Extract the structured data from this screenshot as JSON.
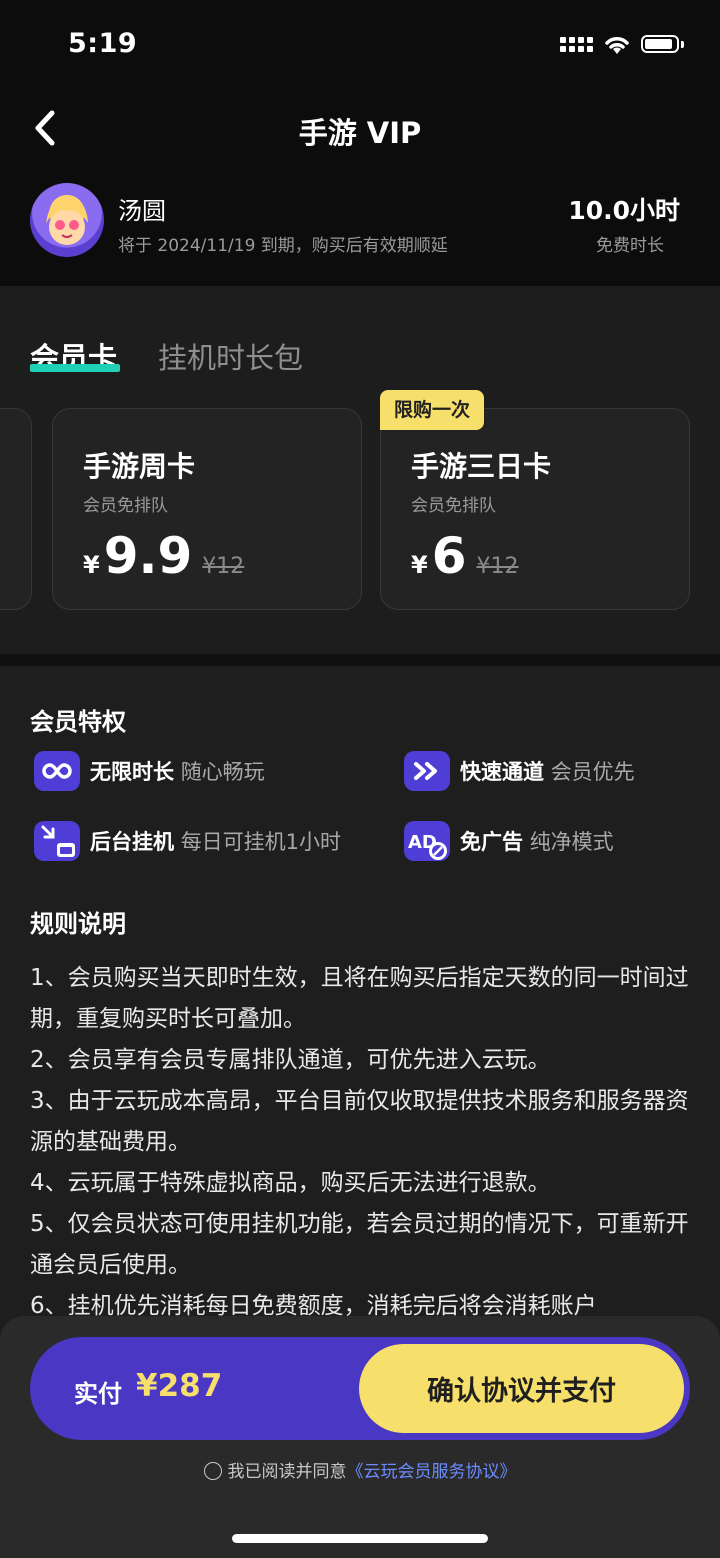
{
  "status": {
    "time": "5:19"
  },
  "header": {
    "title": "手游 VIP"
  },
  "user": {
    "name": "汤圆",
    "expire": "将于 2024/11/19 到期，购买后有效期顺延",
    "hours": "10.0小时",
    "hours_label": "免费时长"
  },
  "tabs": [
    {
      "label": "会员卡",
      "active": true
    },
    {
      "label": "挂机时长包",
      "active": false
    }
  ],
  "cards": [
    {
      "name": "手游周卡",
      "sub": "会员免排队",
      "currency": "¥",
      "price": "9.9",
      "old": "¥12"
    },
    {
      "name": "手游三日卡",
      "sub": "会员免排队",
      "currency": "¥",
      "price": "6",
      "old": "¥12",
      "badge": "限购一次"
    }
  ],
  "privileges": {
    "title": "会员特权",
    "items": [
      {
        "icon": "infinity-icon",
        "name": "无限时长",
        "desc": "随心畅玩"
      },
      {
        "icon": "fast-forward-icon",
        "name": "快速通道",
        "desc": "会员优先"
      },
      {
        "icon": "minimize-window-icon",
        "name": "后台挂机",
        "desc": "每日可挂机1小时"
      },
      {
        "icon": "no-ads-icon",
        "name": "免广告",
        "desc": "纯净模式"
      }
    ]
  },
  "rules": {
    "title": "规则说明",
    "lines": [
      "1、会员购买当天即时生效，且将在购买后指定天数的同一时间过期，重复购买时长可叠加。",
      "2、会员享有会员专属排队通道，可优先进入云玩。",
      "3、由于云玩成本高昂，平台目前仅收取提供技术服务和服务器资源的基础费用。",
      "4、云玩属于特殊虚拟商品，购买后无法进行退款。",
      "5、仅会员状态可使用挂机功能，若会员过期的情况下，可重新开通会员后使用。",
      "6、挂机优先消耗每日免费额度，消耗完后将会消耗账户"
    ]
  },
  "payment": {
    "paid_label": "实付",
    "amount": "¥287",
    "confirm_label": "确认协议并支付",
    "agree_text": "我已阅读并同意",
    "agree_link": "《云玩会员服务协议》"
  },
  "colors": {
    "accent": "#4a37c4",
    "highlight": "#f7df6c",
    "tab_underline": "#1fd1b5"
  }
}
